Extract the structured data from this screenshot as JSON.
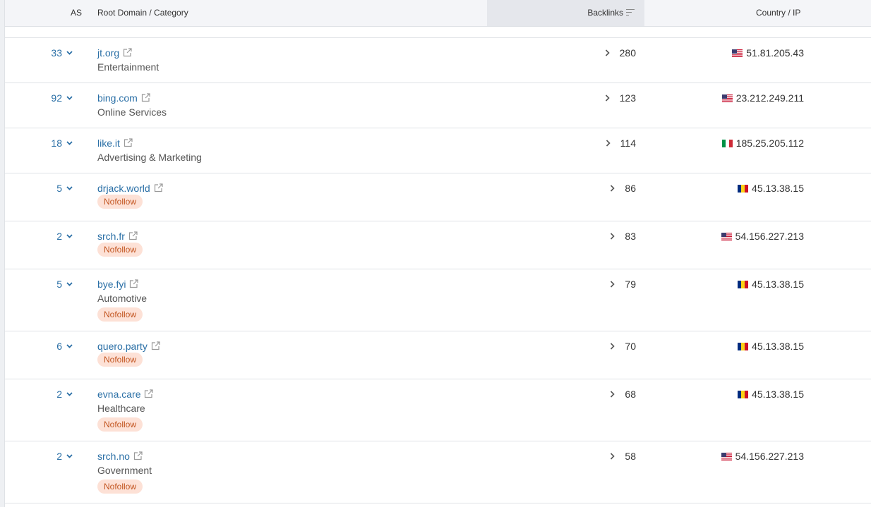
{
  "header": {
    "as": "AS",
    "domain": "Root Domain / Category",
    "backlinks": "Backlinks",
    "country": "Country / IP"
  },
  "rows": [
    {
      "as": "33",
      "domain": "jt.org",
      "category": "Entertainment",
      "nofollow": "",
      "backlinks": "280",
      "flag": "us",
      "ip": "51.81.205.43"
    },
    {
      "as": "92",
      "domain": "bing.com",
      "category": "Online Services",
      "nofollow": "",
      "backlinks": "123",
      "flag": "us",
      "ip": "23.212.249.211"
    },
    {
      "as": "18",
      "domain": "like.it",
      "category": "Advertising & Marketing",
      "nofollow": "",
      "backlinks": "114",
      "flag": "it",
      "ip": "185.25.205.112"
    },
    {
      "as": "5",
      "domain": "drjack.world",
      "category": "",
      "nofollow": "Nofollow",
      "backlinks": "86",
      "flag": "ro",
      "ip": "45.13.38.15"
    },
    {
      "as": "2",
      "domain": "srch.fr",
      "category": "",
      "nofollow": "Nofollow",
      "backlinks": "83",
      "flag": "us",
      "ip": "54.156.227.213"
    },
    {
      "as": "5",
      "domain": "bye.fyi",
      "category": "Automotive",
      "nofollow": "Nofollow",
      "backlinks": "79",
      "flag": "ro",
      "ip": "45.13.38.15"
    },
    {
      "as": "6",
      "domain": "quero.party",
      "category": "",
      "nofollow": "Nofollow",
      "backlinks": "70",
      "flag": "ro",
      "ip": "45.13.38.15"
    },
    {
      "as": "2",
      "domain": "evna.care",
      "category": "Healthcare",
      "nofollow": "Nofollow",
      "backlinks": "68",
      "flag": "ro",
      "ip": "45.13.38.15"
    },
    {
      "as": "2",
      "domain": "srch.no",
      "category": "Government",
      "nofollow": "Nofollow",
      "backlinks": "58",
      "flag": "us",
      "ip": "54.156.227.213"
    }
  ]
}
